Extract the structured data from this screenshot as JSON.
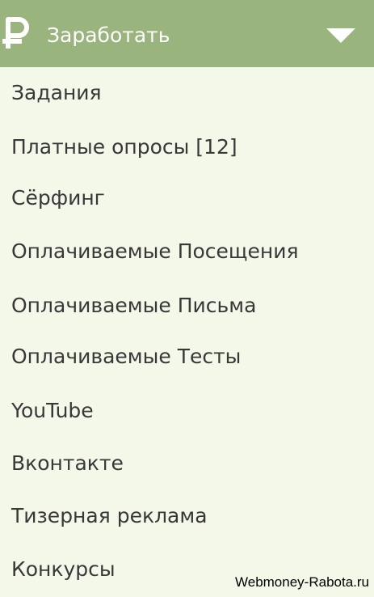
{
  "header": {
    "icon": "ruble-icon",
    "title": "Заработать",
    "toggle_icon": "chevron-down-icon",
    "text_color": "#ffffff",
    "background_color": "#99b57d"
  },
  "menu": {
    "background_color": "#f4f8e8",
    "text_color": "#383838",
    "items": [
      {
        "label": "Задания"
      },
      {
        "label": "Платные опросы [12]"
      },
      {
        "label": "Сёрфинг"
      },
      {
        "label": "Оплачиваемые Посещения"
      },
      {
        "label": "Оплачиваемые Письма"
      },
      {
        "label": "Оплачиваемые Тесты"
      },
      {
        "label": "YouTube"
      },
      {
        "label": "Вконтакте"
      },
      {
        "label": "Тизерная реклама"
      },
      {
        "label": "Конкурсы"
      }
    ]
  },
  "watermark": {
    "text": "Webmoney-Rabota.ru"
  }
}
